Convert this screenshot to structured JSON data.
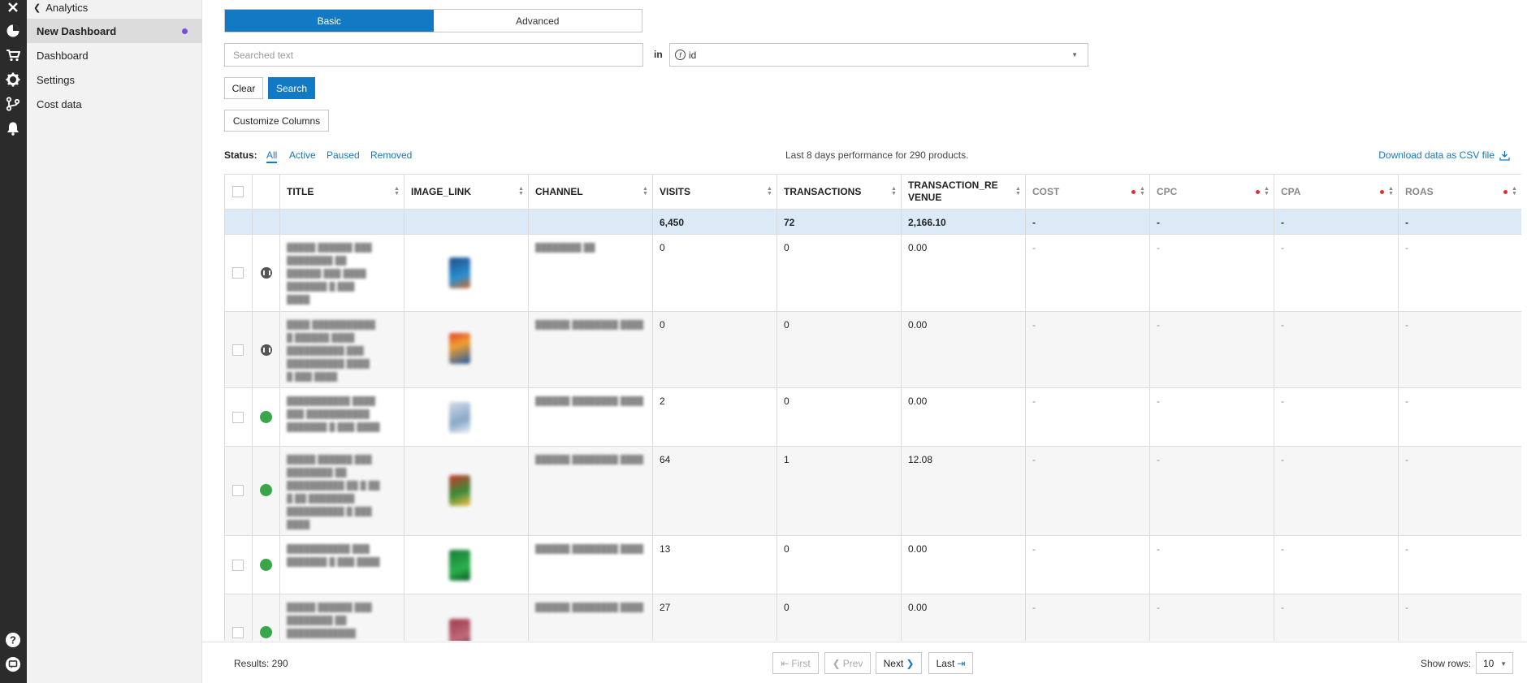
{
  "sidebar": {
    "back_label": "Analytics",
    "items": [
      {
        "label": "New Dashboard",
        "active": true
      },
      {
        "label": "Dashboard"
      },
      {
        "label": "Settings"
      },
      {
        "label": "Cost data"
      }
    ]
  },
  "rail_icons": [
    "close-icon",
    "pie-chart-icon",
    "cart-icon",
    "gear-icon",
    "branch-icon",
    "bell-icon",
    "help-icon",
    "feedback-icon"
  ],
  "search": {
    "tabs": [
      "Basic",
      "Advanced"
    ],
    "active_tab": "Basic",
    "placeholder": "Searched text",
    "value": "",
    "in_label": "in",
    "field_icon": "f",
    "field_value": "id",
    "clear_label": "Clear",
    "search_label": "Search",
    "customize_label": "Customize Columns"
  },
  "status": {
    "label": "Status:",
    "tabs": [
      "All",
      "Active",
      "Paused",
      "Removed"
    ],
    "selected": "All",
    "performance_text": "Last 8 days performance for 290 products.",
    "csv_label": "Download data as CSV file"
  },
  "table": {
    "columns": [
      {
        "label": "TITLE"
      },
      {
        "label": "IMAGE_LINK"
      },
      {
        "label": "CHANNEL"
      },
      {
        "label": "VISITS"
      },
      {
        "label": "TRANSACTIONS"
      },
      {
        "label": "TRANSACTION_RE VENUE"
      },
      {
        "label": "COST",
        "flagged": true
      },
      {
        "label": "CPC",
        "flagged": true
      },
      {
        "label": "CPA",
        "flagged": true
      },
      {
        "label": "ROAS",
        "flagged": true
      }
    ],
    "totals": {
      "visits": "6,450",
      "transactions": "72",
      "revenue": "2,166.10",
      "cost": "-",
      "cpc": "-",
      "cpa": "-",
      "roas": "-"
    },
    "rows": [
      {
        "status": "paused",
        "visits": "0",
        "transactions": "0",
        "revenue": "0.00",
        "cost": "-",
        "cpc": "-",
        "cpa": "-",
        "roas": "-"
      },
      {
        "status": "paused",
        "visits": "0",
        "transactions": "0",
        "revenue": "0.00",
        "cost": "-",
        "cpc": "-",
        "cpa": "-",
        "roas": "-"
      },
      {
        "status": "active",
        "visits": "2",
        "transactions": "0",
        "revenue": "0.00",
        "cost": "-",
        "cpc": "-",
        "cpa": "-",
        "roas": "-"
      },
      {
        "status": "active",
        "visits": "64",
        "transactions": "1",
        "revenue": "12.08",
        "cost": "-",
        "cpc": "-",
        "cpa": "-",
        "roas": "-"
      },
      {
        "status": "active",
        "visits": "13",
        "transactions": "0",
        "revenue": "0.00",
        "cost": "-",
        "cpc": "-",
        "cpa": "-",
        "roas": "-"
      },
      {
        "status": "active",
        "visits": "27",
        "transactions": "0",
        "revenue": "0.00",
        "cost": "-",
        "cpc": "-",
        "cpa": "-",
        "roas": "-"
      }
    ]
  },
  "footer": {
    "results": "Results: 290",
    "first": "First",
    "prev": "Prev",
    "next": "Next",
    "last": "Last",
    "show_rows_label": "Show rows:",
    "rows_value": "10"
  },
  "colors": {
    "accent": "#127ac4",
    "active_status": "#3aa64a",
    "paused_status": "#555555",
    "flag": "#e03030",
    "totals_bg": "#dceaf7",
    "unsaved_dot": "#7c4ddb"
  }
}
